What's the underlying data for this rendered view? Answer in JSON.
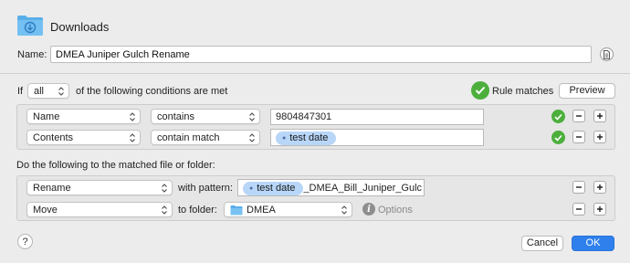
{
  "header": {
    "title": "Downloads",
    "name_label": "Name:",
    "name_value": "DMEA Juniper Gulch Rename"
  },
  "conditions": {
    "if_label": "If",
    "quantifier": "all",
    "suffix": "of the following conditions are met",
    "status": "Rule matches",
    "preview_label": "Preview",
    "rows": [
      {
        "attribute": "Name",
        "operator": "contains",
        "value": "9804847301"
      },
      {
        "attribute": "Contents",
        "operator": "contain match",
        "token": "test date"
      }
    ]
  },
  "actions": {
    "heading": "Do the following to the matched file or folder:",
    "rows": [
      {
        "action": "Rename",
        "connector": "with pattern:",
        "token": "test date",
        "pattern_text": "_DMEA_Bill_Juniper_Gulc"
      },
      {
        "action": "Move",
        "connector": "to folder:",
        "folder": "DMEA",
        "options_label": "Options"
      }
    ]
  },
  "footer": {
    "help": "?",
    "cancel_label": "Cancel",
    "ok_label": "OK"
  },
  "colors": {
    "accent": "#2f80ed",
    "match_green": "#4caf3c",
    "token_blue": "#b8d6f8",
    "folder_blue": "#5aaee8"
  }
}
